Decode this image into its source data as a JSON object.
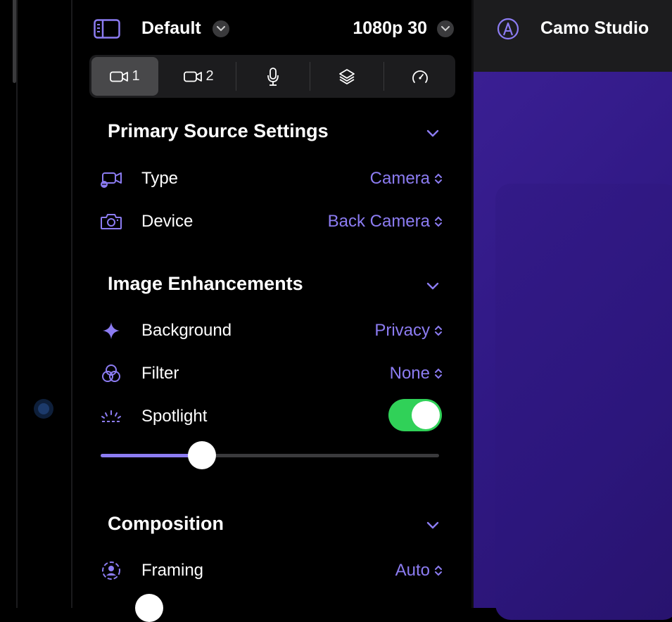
{
  "header": {
    "preset": "Default",
    "resolution": "1080p 30",
    "app_title": "Camo Studio"
  },
  "tabs": [
    {
      "label": "1",
      "icon": "camera-icon",
      "active": true
    },
    {
      "label": "2",
      "icon": "camera-icon",
      "active": false
    },
    {
      "label": "",
      "icon": "microphone-icon",
      "active": false
    },
    {
      "label": "",
      "icon": "layers-icon",
      "active": false
    },
    {
      "label": "",
      "icon": "speedometer-icon",
      "active": false
    }
  ],
  "primary_source": {
    "title": "Primary Source Settings",
    "type_label": "Type",
    "type_value": "Camera",
    "device_label": "Device",
    "device_value": "Back Camera"
  },
  "image_enhancements": {
    "title": "Image Enhancements",
    "background_label": "Background",
    "background_value": "Privacy",
    "filter_label": "Filter",
    "filter_value": "None",
    "spotlight_label": "Spotlight",
    "spotlight_on": true,
    "spotlight_level": 0.3
  },
  "composition": {
    "title": "Composition",
    "framing_label": "Framing",
    "framing_value": "Auto"
  },
  "colors": {
    "accent": "#8c7cf2",
    "toggle_on": "#30d158",
    "panel_bg": "#000000",
    "preview_bg": "#2f1883"
  }
}
